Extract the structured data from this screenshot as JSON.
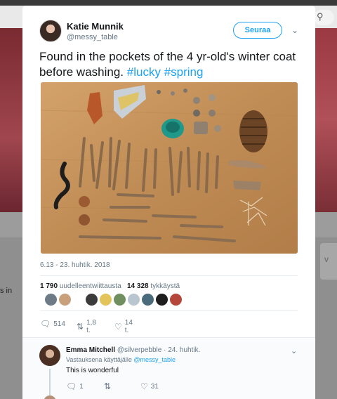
{
  "background": {
    "left_fragment_text": "s in",
    "search_icon": "search-icon",
    "right_panel_glyph": "v"
  },
  "tweet": {
    "author_name": "Katie Munnik",
    "author_handle": "@messy_table",
    "follow_label": "Seuraa",
    "text_plain": "Found in the pockets of the 4 yr-old's winter coat before washing.",
    "hashtags": [
      "#lucky",
      "#spring"
    ],
    "photo_alt_icon": "photo-of-found-objects",
    "timestamp": "6.13 - 23. huhtik. 2018",
    "retweets_count": "1 790",
    "retweets_label": "uudelleentwiittausta",
    "likes_count": "14 328",
    "likes_label": "tykkäystä",
    "liker_colors": [
      "#6d7b86",
      "#c8a07c",
      "#3b3b3b",
      "#e3c45a",
      "#6f8f5e",
      "#b9c6cf",
      "#4a6b7c",
      "#1e1e1e",
      "#b4463a"
    ],
    "actions": {
      "reply_count": "514",
      "retweet_count": "1,8 t.",
      "like_count": "14 t."
    }
  },
  "reply": {
    "name": "Emma Mitchell",
    "handle": "@silverpebble",
    "date": "· 24. huhtik.",
    "replying_prefix": "Vastauksena käyttäjälle",
    "replying_handle": "@messy_table",
    "text": "This is wonderful",
    "reply_count": "1",
    "retweet_count": "",
    "like_count": "31"
  },
  "colors": {
    "accent": "#1da1f2",
    "text": "#14171a",
    "muted": "#657786"
  }
}
